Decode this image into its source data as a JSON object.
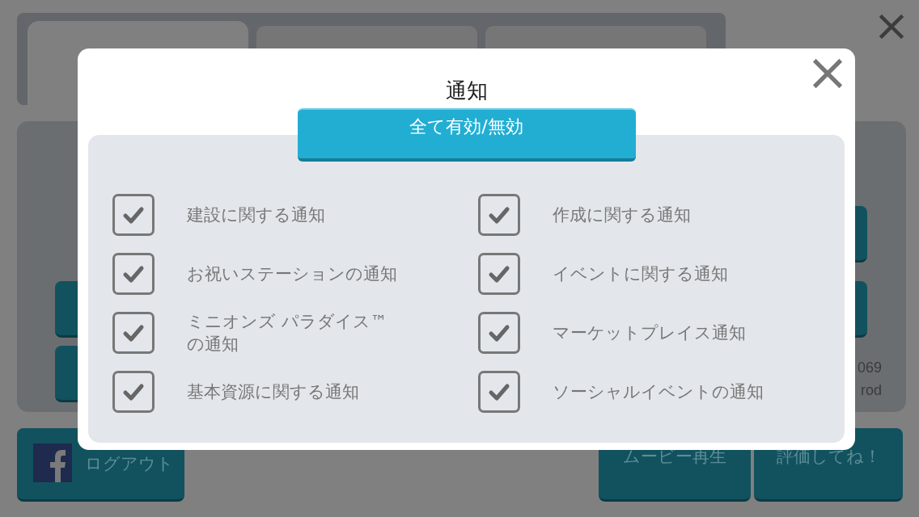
{
  "background": {
    "tabs": [
      {
        "selected": true
      },
      {
        "selected": false
      },
      {
        "selected": false
      }
    ],
    "side_texts": [
      "069",
      "rod"
    ],
    "logout_button": {
      "label": "ログアウト"
    },
    "movie_button": {
      "label": "ムービー再生"
    },
    "rate_button": {
      "label": "評価してね！"
    }
  },
  "dialog": {
    "title": "通知",
    "toggle_all_button": "全て有効/無効",
    "options": [
      {
        "label": "建設に関する通知",
        "checked": true
      },
      {
        "label": "作成に関する通知",
        "checked": true
      },
      {
        "label": "お祝いステーションの通知",
        "checked": true
      },
      {
        "label": "イベントに関する通知",
        "checked": true
      },
      {
        "label": "ミニオンズ パラダイス™\nの通知",
        "checked": true
      },
      {
        "label": "マーケットプレイス通知",
        "checked": true
      },
      {
        "label": "基本資源に関する通知",
        "checked": true
      },
      {
        "label": "ソーシャルイベントの通知",
        "checked": true
      }
    ]
  }
}
